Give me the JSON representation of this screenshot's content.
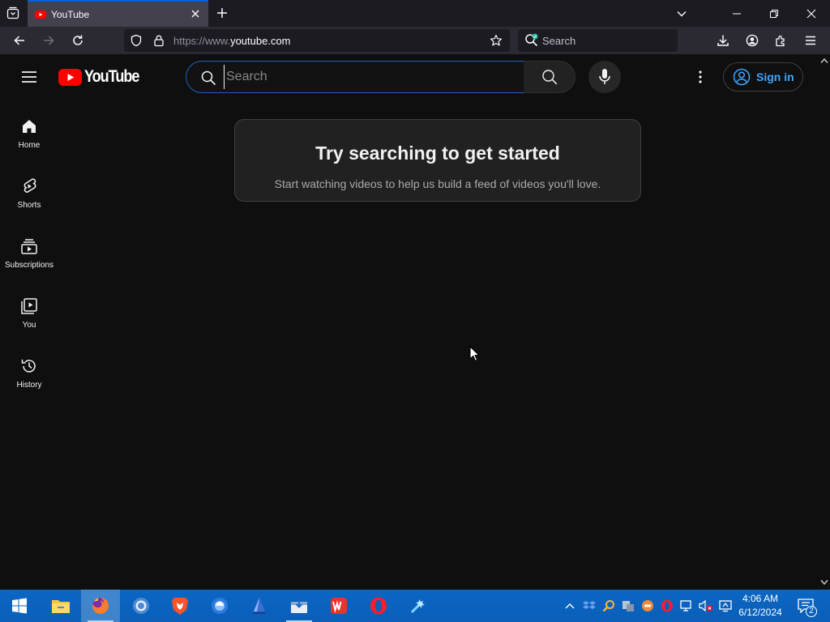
{
  "browser": {
    "tab_title": "YouTube",
    "url_scheme": "https://www.",
    "url_host": "youtube.com",
    "search_placeholder": "Search"
  },
  "youtube": {
    "logo_text": "YouTube",
    "search_placeholder": "Search",
    "sign_in_label": "Sign in",
    "guide": [
      {
        "label": "Home"
      },
      {
        "label": "Shorts"
      },
      {
        "label": "Subscriptions"
      },
      {
        "label": "You"
      },
      {
        "label": "History"
      }
    ],
    "empty_state": {
      "title": "Try searching to get started",
      "subtitle": "Start watching videos to help us build a feed of videos you'll love."
    }
  },
  "taskbar": {
    "time": "4:06 AM",
    "date": "6/12/2024",
    "notification_count": "2"
  },
  "colors": {
    "yt_red": "#ff0000",
    "yt_background": "#0f0f0f",
    "sign_in_blue": "#3ea6ff",
    "search_focus_border": "#1c62b9",
    "browser_accent": "#0060df",
    "taskbar_blue": "#0a5fb8"
  },
  "icons": [
    "tab-list-icon",
    "youtube-favicon",
    "close-tab-icon",
    "new-tab-icon",
    "chevron-down-icon",
    "minimize-icon",
    "restore-icon",
    "close-window-icon",
    "back-icon",
    "forward-icon",
    "reload-icon",
    "shield-icon",
    "lock-icon",
    "star-icon",
    "search-engine-icon",
    "download-icon",
    "account-icon",
    "extensions-icon",
    "menu-icon",
    "hamburger-icon",
    "search-icon",
    "mic-icon",
    "more-vert-icon",
    "user-circle-icon",
    "home-icon",
    "shorts-icon",
    "subscriptions-icon",
    "you-icon",
    "history-icon",
    "windows-start-icon",
    "file-explorer-icon",
    "firefox-icon",
    "chrome-icon",
    "brave-icon",
    "browser-icon",
    "sailboat-icon",
    "installer-icon",
    "wps-icon",
    "opera-icon",
    "tool-icon",
    "show-hidden-icons",
    "notification-icon"
  ]
}
